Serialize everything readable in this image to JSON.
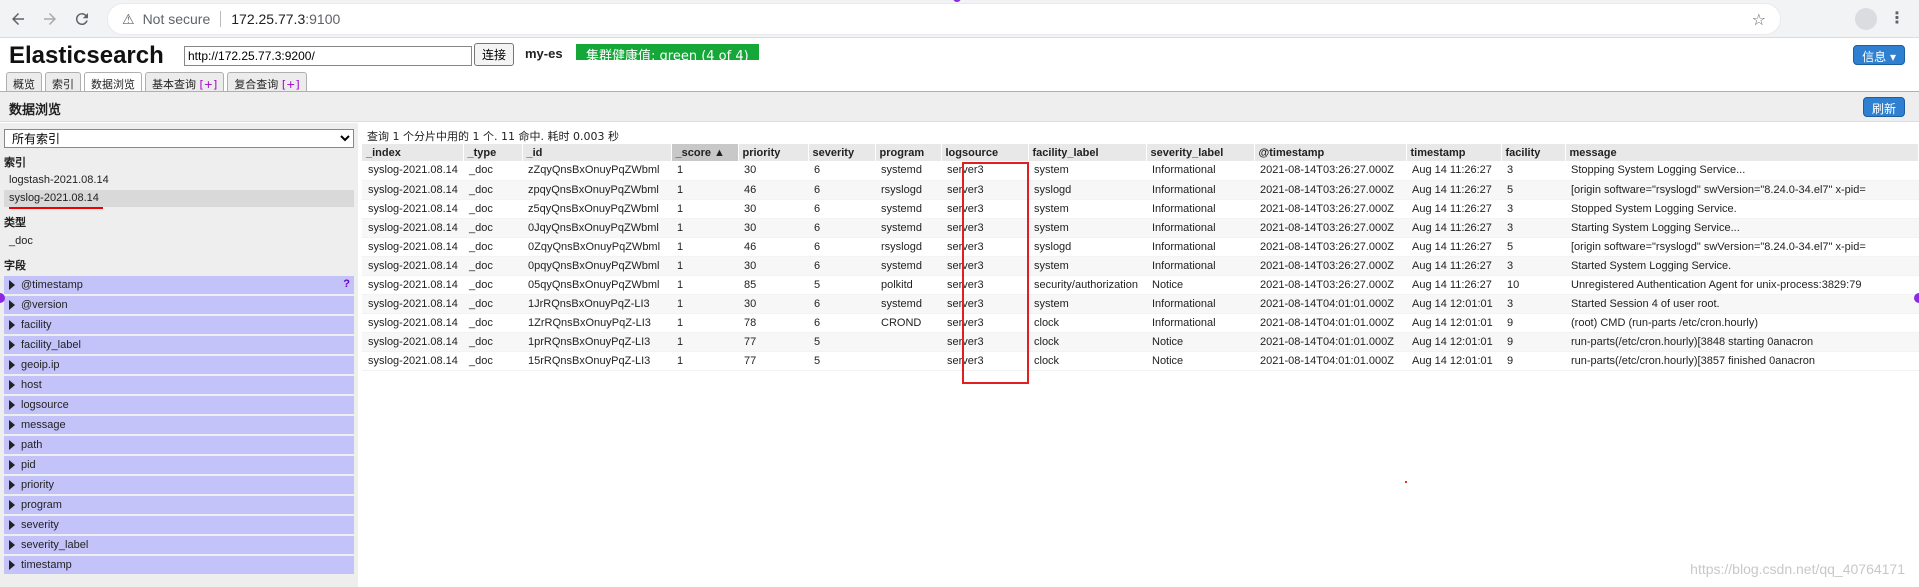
{
  "browser": {
    "security_label": "Not secure",
    "url_host": "172.25.77.3",
    "url_port": ":9100"
  },
  "app": {
    "title": "Elasticsearch",
    "connect_url": "http://172.25.77.3:9200/",
    "connect_label": "连接",
    "cluster_name": "my-es",
    "cluster_health": "集群健康值: green (4 of 4)",
    "info_label": "信息 ▾",
    "health_color": "#15a839"
  },
  "tabs": [
    {
      "label": "概览"
    },
    {
      "label": "索引"
    },
    {
      "label": "数据浏览"
    },
    {
      "label": "基本查询",
      "plus": "[+]"
    },
    {
      "label": "复合查询",
      "plus": "[+]"
    }
  ],
  "section": {
    "title": "数据浏览",
    "refresh_label": "刷新"
  },
  "sidebar": {
    "index_select": "所有索引",
    "indices_heading": "索引",
    "indices": [
      "logstash-2021.08.14",
      "syslog-2021.08.14"
    ],
    "types_heading": "类型",
    "types": [
      "_doc"
    ],
    "fields_heading": "字段",
    "fields": [
      "@timestamp",
      "@version",
      "facility",
      "facility_label",
      "geoip.ip",
      "host",
      "logsource",
      "message",
      "path",
      "pid",
      "priority",
      "program",
      "severity",
      "severity_label",
      "timestamp"
    ]
  },
  "results": {
    "info": "查询 1 个分片中用的 1 个. 11 命中. 耗时 0.003 秒",
    "columns": [
      "_index",
      "_type",
      "_id",
      "_score ▲",
      "priority",
      "severity",
      "program",
      "logsource",
      "facility_label",
      "severity_label",
      "@timestamp",
      "timestamp",
      "facility",
      "message"
    ],
    "rows": [
      [
        "syslog-2021.08.14",
        "_doc",
        "zZqyQnsBxOnuyPqZWbml",
        "1",
        "30",
        "6",
        "systemd",
        "server3",
        "system",
        "Informational",
        "2021-08-14T03:26:27.000Z",
        "Aug 14 11:26:27",
        "3",
        "Stopping System Logging Service..."
      ],
      [
        "syslog-2021.08.14",
        "_doc",
        "zpqyQnsBxOnuyPqZWbml",
        "1",
        "46",
        "6",
        "rsyslogd",
        "server3",
        "syslogd",
        "Informational",
        "2021-08-14T03:26:27.000Z",
        "Aug 14 11:26:27",
        "5",
        "[origin software=\"rsyslogd\" swVersion=\"8.24.0-34.el7\" x-pid="
      ],
      [
        "syslog-2021.08.14",
        "_doc",
        "z5qyQnsBxOnuyPqZWbml",
        "1",
        "30",
        "6",
        "systemd",
        "server3",
        "system",
        "Informational",
        "2021-08-14T03:26:27.000Z",
        "Aug 14 11:26:27",
        "3",
        "Stopped System Logging Service."
      ],
      [
        "syslog-2021.08.14",
        "_doc",
        "0JqyQnsBxOnuyPqZWbml",
        "1",
        "30",
        "6",
        "systemd",
        "server3",
        "system",
        "Informational",
        "2021-08-14T03:26:27.000Z",
        "Aug 14 11:26:27",
        "3",
        "Starting System Logging Service..."
      ],
      [
        "syslog-2021.08.14",
        "_doc",
        "0ZqyQnsBxOnuyPqZWbml",
        "1",
        "46",
        "6",
        "rsyslogd",
        "server3",
        "syslogd",
        "Informational",
        "2021-08-14T03:26:27.000Z",
        "Aug 14 11:26:27",
        "5",
        "[origin software=\"rsyslogd\" swVersion=\"8.24.0-34.el7\" x-pid="
      ],
      [
        "syslog-2021.08.14",
        "_doc",
        "0pqyQnsBxOnuyPqZWbml",
        "1",
        "30",
        "6",
        "systemd",
        "server3",
        "system",
        "Informational",
        "2021-08-14T03:26:27.000Z",
        "Aug 14 11:26:27",
        "3",
        "Started System Logging Service."
      ],
      [
        "syslog-2021.08.14",
        "_doc",
        "05qyQnsBxOnuyPqZWbml",
        "1",
        "85",
        "5",
        "polkitd",
        "server3",
        "security/authorization",
        "Notice",
        "2021-08-14T03:26:27.000Z",
        "Aug 14 11:26:27",
        "10",
        "Unregistered Authentication Agent for unix-process:3829:79"
      ],
      [
        "syslog-2021.08.14",
        "_doc",
        "1JrRQnsBxOnuyPqZ-LI3",
        "1",
        "30",
        "6",
        "systemd",
        "server3",
        "system",
        "Informational",
        "2021-08-14T04:01:01.000Z",
        "Aug 14 12:01:01",
        "3",
        "Started Session 4 of user root."
      ],
      [
        "syslog-2021.08.14",
        "_doc",
        "1ZrRQnsBxOnuyPqZ-LI3",
        "1",
        "78",
        "6",
        "CROND",
        "server3",
        "clock",
        "Informational",
        "2021-08-14T04:01:01.000Z",
        "Aug 14 12:01:01",
        "9",
        "(root) CMD (run-parts /etc/cron.hourly)"
      ],
      [
        "syslog-2021.08.14",
        "_doc",
        "1prRQnsBxOnuyPqZ-LI3",
        "1",
        "77",
        "5",
        "",
        "server3",
        "clock",
        "Notice",
        "2021-08-14T04:01:01.000Z",
        "Aug 14 12:01:01",
        "9",
        "run-parts(/etc/cron.hourly)[3848 starting 0anacron"
      ],
      [
        "syslog-2021.08.14",
        "_doc",
        "15rRQnsBxOnuyPqZ-LI3",
        "1",
        "77",
        "5",
        "",
        "server3",
        "clock",
        "Notice",
        "2021-08-14T04:01:01.000Z",
        "Aug 14 12:01:01",
        "9",
        "run-parts(/etc/cron.hourly)[3857 finished 0anacron"
      ]
    ]
  },
  "watermark": "https://blog.csdn.net/qq_40764171"
}
